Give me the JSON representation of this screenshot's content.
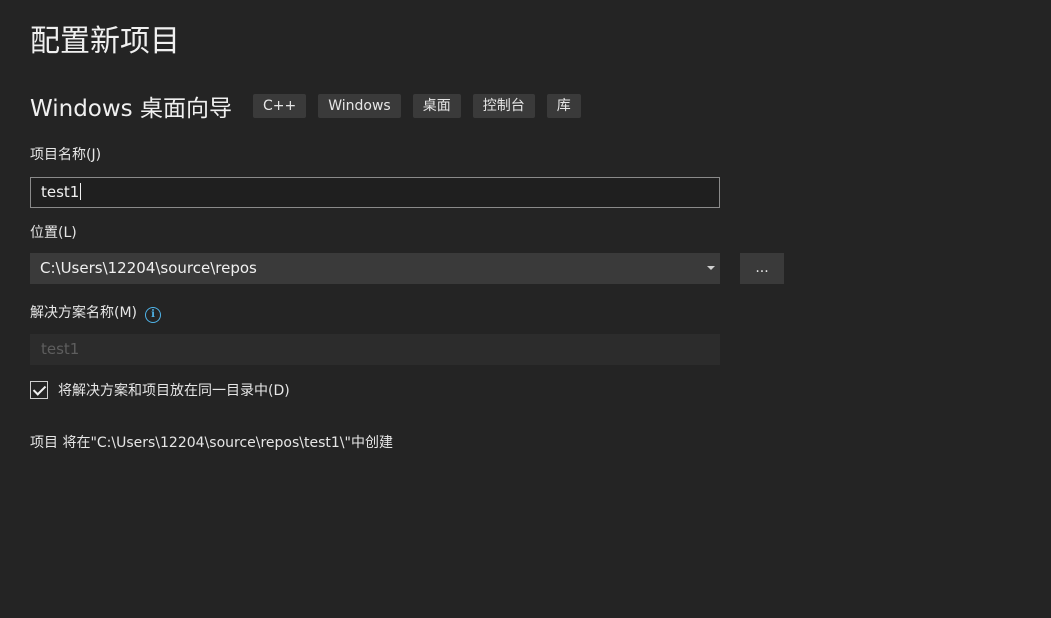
{
  "page": {
    "title": "配置新项目"
  },
  "template": {
    "name": "Windows 桌面向导",
    "tags": [
      "C++",
      "Windows",
      "桌面",
      "控制台",
      "库"
    ]
  },
  "project_name": {
    "label": "项目名称(J)",
    "value": "test1"
  },
  "location": {
    "label": "位置(L)",
    "value": "C:\\Users\\12204\\source\\repos",
    "browse_label": "..."
  },
  "solution_name": {
    "label": "解决方案名称(M)",
    "info_glyph": "i",
    "value": "test1"
  },
  "same_directory": {
    "label": "将解决方案和项目放在同一目录中(D)",
    "checked": true
  },
  "summary": {
    "text": "项目 将在\"C:\\Users\\12204\\source\\repos\\test1\\\"中创建"
  },
  "colors": {
    "background": "#242424",
    "accent_info": "#4fb3e8",
    "tag_background": "#3a3a3a"
  }
}
